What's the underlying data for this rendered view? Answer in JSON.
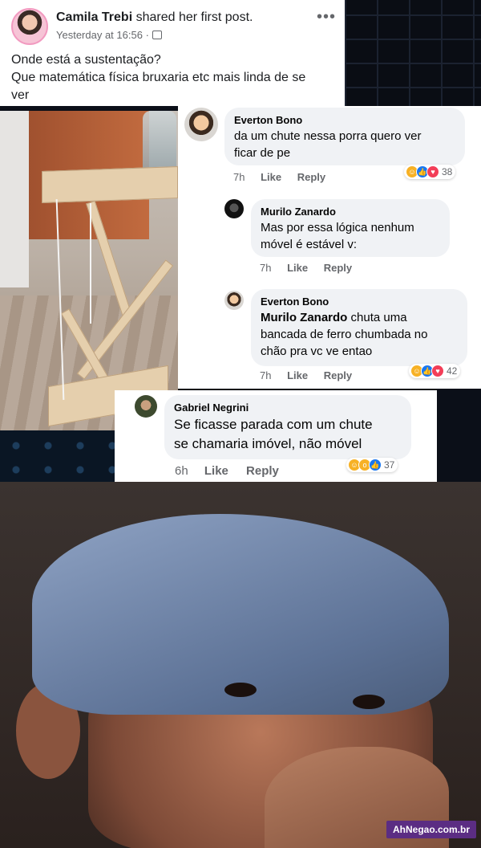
{
  "post": {
    "author": "Camila Trebi",
    "action": "shared her first post.",
    "time": "Yesterday at 16:56",
    "text_lines": [
      "Onde está a sustentação?",
      "Que matemática física bruxaria etc mais linda de se",
      "ver"
    ]
  },
  "comments": [
    {
      "name": "Everton Bono",
      "lines": [
        "da um chute nessa porra quero ver",
        "ficar de pe"
      ],
      "time": "7h",
      "like": "Like",
      "reply": "Reply",
      "reactions": [
        "haha",
        "like",
        "love"
      ],
      "count": "38"
    },
    {
      "name": "Murilo Zanardo",
      "lines": [
        "Mas por essa lógica nenhum",
        "móvel é estável v:"
      ],
      "time": "7h",
      "like": "Like",
      "reply": "Reply"
    },
    {
      "name": "Everton Bono",
      "mention": "Murilo Zanardo",
      "lines": [
        " chuta uma",
        "bancada de ferro chumbada no",
        "chão pra vc ve entao"
      ],
      "time": "7h",
      "like": "Like",
      "reply": "Reply",
      "reactions": [
        "haha",
        "like",
        "love"
      ],
      "count": "42"
    },
    {
      "name": "Gabriel Negrini",
      "lines": [
        "Se ficasse parada com um chute",
        "se chamaria imóvel, não móvel"
      ],
      "time": "6h",
      "like": "Like",
      "reply": "Reply",
      "reactions": [
        "haha",
        "wow",
        "like"
      ],
      "count": "37"
    }
  ],
  "watermark": "AhNegao.com.br",
  "colors": {
    "like_blue": "#1877f2",
    "bubble": "#f0f2f5",
    "meta_gray": "#65676b"
  }
}
